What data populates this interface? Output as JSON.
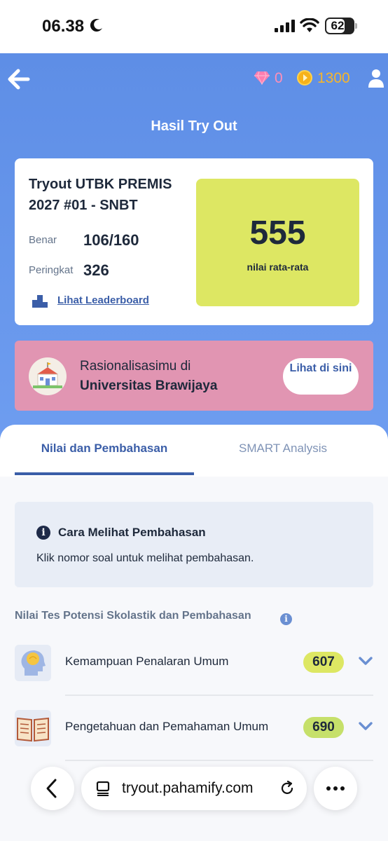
{
  "status_bar": {
    "time": "06.38",
    "battery": "62"
  },
  "header": {
    "gem_count": "0",
    "coin_count": "1300",
    "title": "Hasil Try Out"
  },
  "result": {
    "tryout_name": "Tryout UTBK PREMIS 2027 #01 - SNBT",
    "benar_label": "Benar",
    "benar_value": "106/160",
    "peringkat_label": "Peringkat",
    "peringkat_value": "326",
    "leaderboard_link": "Lihat Leaderboard",
    "score": "555",
    "score_label": "nilai rata-rata"
  },
  "rasionalisasi": {
    "line1": "Rasionalisasimu di",
    "university": "Universitas Brawijaya",
    "button": "Lihat di sini"
  },
  "tabs": [
    {
      "label": "Nilai dan Pembahasan"
    },
    {
      "label": "SMART Analysis"
    }
  ],
  "info": {
    "title": "Cara Melihat Pembahasan",
    "body": "Klik nomor soal untuk melihat pembahasan."
  },
  "section": {
    "title": "Nilai Tes Potensi Skolastik dan Pembahasan"
  },
  "subtests": [
    {
      "name": "Kemampuan Penalaran Umum",
      "score": "607"
    },
    {
      "name": "Pengetahuan dan Pemahaman Umum",
      "score": "690"
    }
  ],
  "browser": {
    "url": "tryout.pahamify.com"
  },
  "colors": {
    "primary": "#3b5ea8",
    "hero": "#6e9df0",
    "score_bg": "#dde763",
    "rasional_bg": "#e195b2"
  }
}
